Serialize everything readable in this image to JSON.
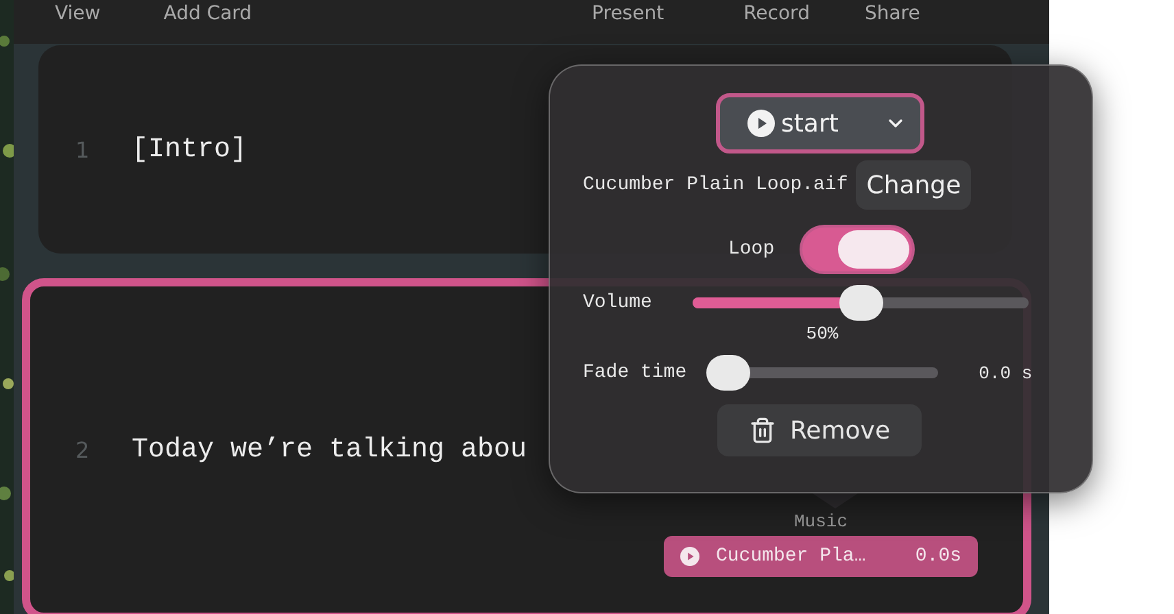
{
  "toolbar": {
    "left": [
      "View",
      "Add Card"
    ],
    "right": [
      "Present",
      "Record",
      "Share"
    ]
  },
  "cards": [
    {
      "number": "1",
      "text": "[Intro]",
      "selected": false
    },
    {
      "number": "2",
      "text": "Today we’re talking abou",
      "selected": true,
      "clip": {
        "label": "Music",
        "name": "Cucumber Pla…",
        "time": "0.0s"
      }
    }
  ],
  "popover": {
    "start_button": "start",
    "file_name": "Cucumber Plain Loop.aif",
    "change_button": "Change",
    "loop": {
      "label": "Loop",
      "on": true
    },
    "volume": {
      "label": "Volume",
      "level": 0.5,
      "reading": "50%"
    },
    "fade": {
      "label": "Fade time",
      "level": 0,
      "reading": "0.0 s"
    },
    "remove_button": "Remove"
  }
}
